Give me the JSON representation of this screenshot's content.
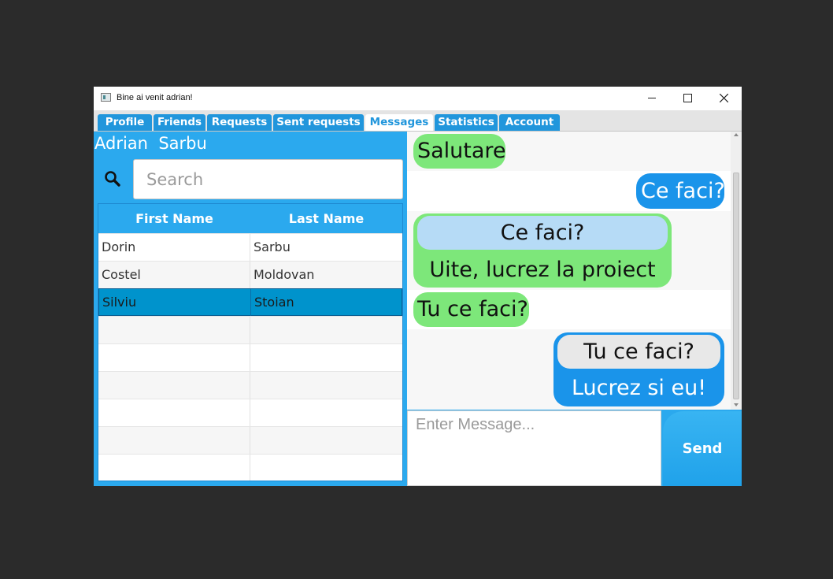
{
  "window": {
    "title": "Bine ai venit adrian!"
  },
  "tabs": [
    {
      "label": "Profile",
      "active": false
    },
    {
      "label": "Friends",
      "active": false
    },
    {
      "label": "Requests",
      "active": false
    },
    {
      "label": "Sent requests",
      "active": false
    },
    {
      "label": "Messages",
      "active": true
    },
    {
      "label": "Statistics",
      "active": false
    },
    {
      "label": "Account",
      "active": false
    }
  ],
  "user": {
    "first_name": "Adrian",
    "last_name": "Sarbu",
    "display": "Adrian  Sarbu"
  },
  "search": {
    "placeholder": "Search",
    "icon": "search-icon"
  },
  "friends_table": {
    "columns": [
      "First Name",
      "Last Name"
    ],
    "rows": [
      {
        "first": "Dorin",
        "last": "Sarbu"
      },
      {
        "first": "Costel",
        "last": "Moldovan"
      },
      {
        "first": "Silviu",
        "last": "Stoian",
        "selected": true
      }
    ]
  },
  "messages": [
    {
      "from": "other",
      "text": "Salutare"
    },
    {
      "from": "me",
      "text": "Ce faci?"
    },
    {
      "from": "other",
      "reply_to": "Ce faci?",
      "text": "Uite, lucrez la proiect"
    },
    {
      "from": "other",
      "text": "Tu ce faci?"
    },
    {
      "from": "me",
      "reply_to": "Tu ce faci?",
      "text": "Lucrez si eu!"
    }
  ],
  "composer": {
    "placeholder": "Enter Message...",
    "send_label": "Send"
  },
  "colors": {
    "accent": "#2ba9ee",
    "tab": "#2196dc",
    "incoming": "#7de77a",
    "outgoing": "#1a94ea",
    "selected_row": "#0093cc"
  }
}
